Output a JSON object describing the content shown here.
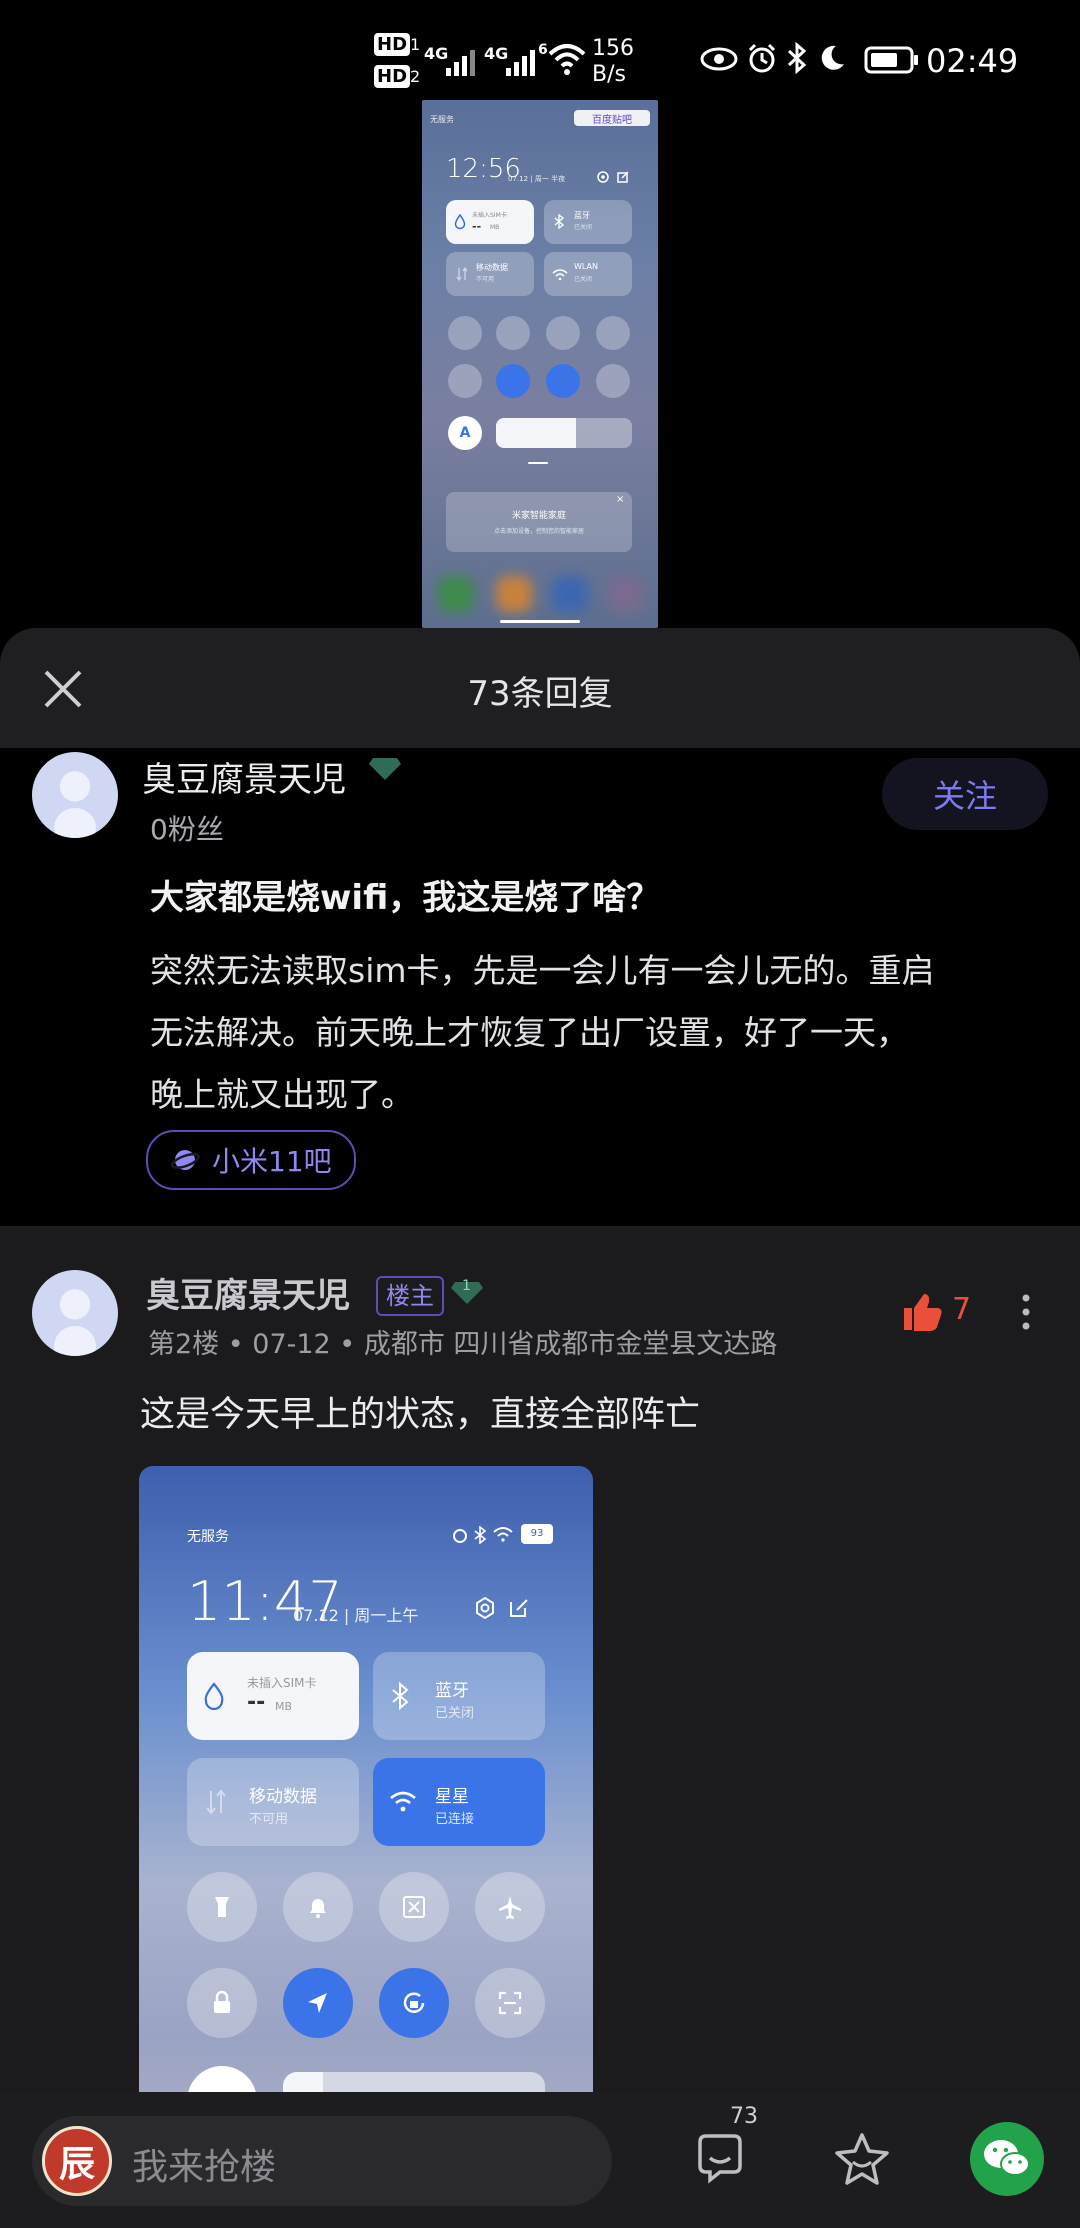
{
  "status_bar": {
    "hd1": "HD",
    "hd1_sub": "1",
    "hd2": "HD",
    "hd2_sub": "2",
    "sig1": "4G",
    "sig2": "4G",
    "wifi_num": "6",
    "speed_value": "156",
    "speed_unit": "B/s",
    "time": "02:49"
  },
  "top_shot": {
    "watermark": "百度贴吧",
    "no_service": "无服务",
    "time": "12:56",
    "date": "07.12 | 周一 半夜",
    "tile_sim_label": "未插入SIM卡",
    "tile_sim_value": "--",
    "tile_sim_unit": "MB",
    "tile_bt_title": "蓝牙",
    "tile_bt_sub": "已关闭",
    "tile_data_title": "移动数据",
    "tile_data_sub": "不可用",
    "tile_wlan_title": "WLAN",
    "tile_wlan_sub": "已关闭",
    "auto_label": "A",
    "card_title": "米家智能家庭",
    "card_sub": "点击添加设备，控制您的智能家居",
    "card_close": "×"
  },
  "sheet": {
    "title": "73条回复",
    "close_icon": "close-icon"
  },
  "post": {
    "username": "臭豆腐景天児",
    "fans": "0粉丝",
    "follow_label": "关注",
    "title": "大家都是烧wifi，我这是烧了啥？",
    "body_line1": "突然无法读取sim卡，先是一会儿有一会儿无的。重启",
    "body_line2": "无法解决。前天晚上才恢复了出厂设置，好了一天，",
    "body_line3": "晚上就又出现了。",
    "forum_tag": "小米11吧"
  },
  "reply": {
    "username": "臭豆腐景天児",
    "badge": "楼主",
    "level": "1",
    "meta": "第2楼 • 07-12 • 成都市 四川省成都市金堂县文达路",
    "like_count": "7",
    "text": "这是今天早上的状态，直接全部阵亡",
    "more_icon": "more-vertical-icon"
  },
  "reply_shot": {
    "no_service": "无服务",
    "battery": "93",
    "time": "11:47",
    "date": "07.12 | 周一上午",
    "tile_sim_label": "未插入SIM卡",
    "tile_sim_value": "--",
    "tile_sim_unit": "MB",
    "tile_bt_title": "蓝牙",
    "tile_bt_sub": "已关闭",
    "tile_data_title": "移动数据",
    "tile_data_sub": "不可用",
    "tile_wifi_title": "星星",
    "tile_wifi_sub": "已连接"
  },
  "bottom_bar": {
    "avatar_char": "辰",
    "input_placeholder": "我来抢楼",
    "comment_count": "73"
  },
  "colors": {
    "accent": "#7c7bf5",
    "like": "#e8503a",
    "wechat": "#22a24a",
    "blue_tile": "#3b73e8"
  }
}
